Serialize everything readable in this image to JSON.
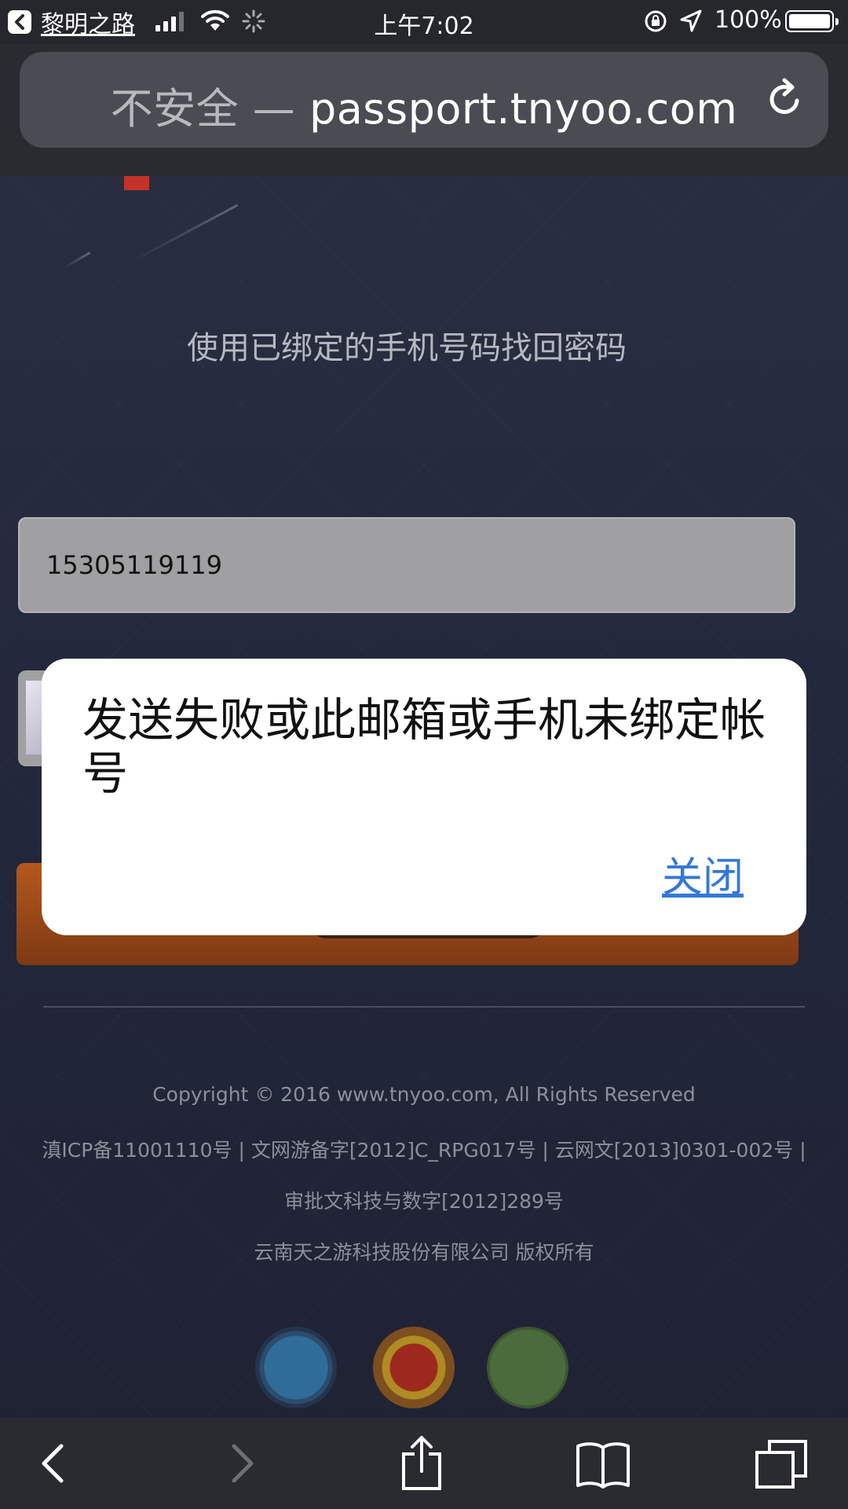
{
  "status_bar": {
    "back_app_label": "黎明之路",
    "time": "上午7:02",
    "battery_percent": "100%",
    "signal_bars": 3,
    "battery_level": 1.0
  },
  "browser": {
    "url_insecure": "不安全 —",
    "url_domain": "passport.tnyoo.com"
  },
  "page": {
    "subtitle": "使用已绑定的手机号码找回密码",
    "phone_value": "15305119119"
  },
  "footer": {
    "copyright": "Copyright © 2016 www.tnyoo.com, All Rights Reserved",
    "licenses": "滇ICP备11001110号 | 文网游备字[2012]C_RPG017号 | 云网文[2013]0301-002号 |",
    "approval": "审批文科技与数字[2012]289号",
    "company": "云南天之游科技股份有限公司 版权所有"
  },
  "alert": {
    "message": "发送失败或此邮箱或手机未绑定帐号",
    "close_label": "关闭"
  },
  "colors": {
    "accent_link": "#3478d8",
    "submit_button": "#b4581c",
    "page_background": "#24283a"
  }
}
